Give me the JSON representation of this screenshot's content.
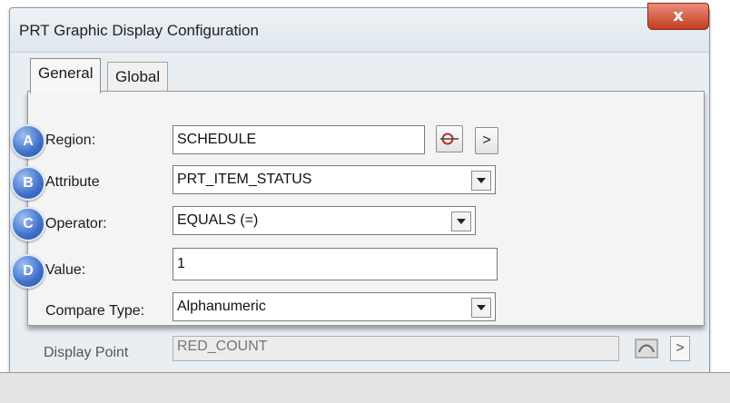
{
  "window": {
    "title": "PRT Graphic Display Configuration",
    "close_label": "x"
  },
  "tabs": [
    {
      "label": "General",
      "active": true
    },
    {
      "label": "Global",
      "active": false
    }
  ],
  "rows": {
    "region": {
      "badge": "A",
      "label": "Region:",
      "value": "SCHEDULE"
    },
    "attribute": {
      "badge": "B",
      "label": "Attribute",
      "value": "PRT_ITEM_STATUS"
    },
    "operator": {
      "badge": "C",
      "label": "Operator:",
      "value": "EQUALS (=)"
    },
    "value": {
      "badge": "D",
      "label": "Value:",
      "value": "1"
    },
    "compare_type": {
      "label": "Compare Type:",
      "value": "Alphanumeric"
    }
  },
  "buttons": {
    "next_label": ">",
    "bg_next_label": ">"
  },
  "display_point": {
    "label": "Display Point",
    "value": "RED_COUNT"
  },
  "colors": {
    "badge": "#3e6fc8",
    "close": "#c43e22"
  }
}
